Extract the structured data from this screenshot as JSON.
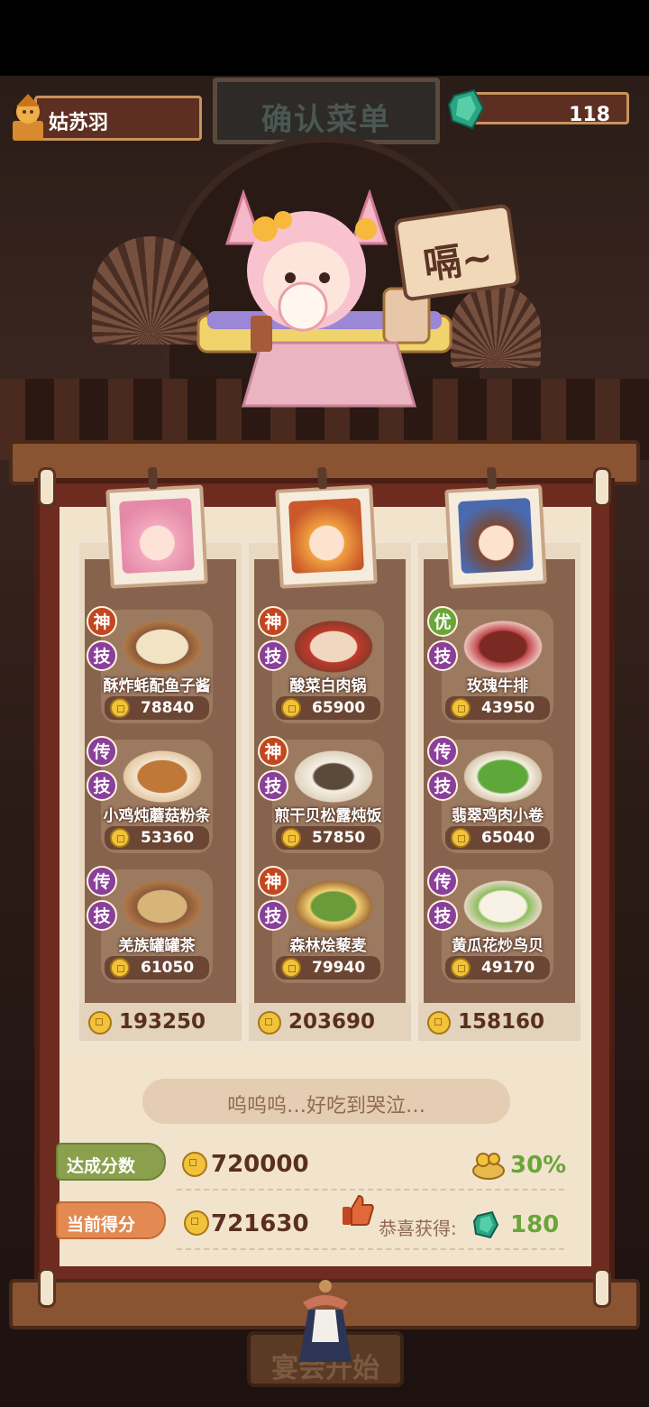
{
  "header": {
    "player_name": "姑苏羽",
    "title": "确认菜单",
    "gems": "118"
  },
  "scene": {
    "speech": "嗝~"
  },
  "columns": [
    {
      "chef": "chef-1",
      "dishes": [
        {
          "rarity": "神",
          "skill": "技",
          "name": "酥炸蚝配鱼子酱",
          "price": "78840"
        },
        {
          "rarity": "传",
          "skill": "技",
          "name": "小鸡炖蘑菇粉条",
          "price": "53360"
        },
        {
          "rarity": "传",
          "skill": "技",
          "name": "羌族罐罐茶",
          "price": "61050"
        }
      ],
      "total": "193250"
    },
    {
      "chef": "chef-2",
      "dishes": [
        {
          "rarity": "神",
          "skill": "技",
          "name": "酸菜白肉锅",
          "price": "65900"
        },
        {
          "rarity": "神",
          "skill": "技",
          "name": "煎干贝松露炖饭",
          "price": "57850"
        },
        {
          "rarity": "神",
          "skill": "技",
          "name": "森林烩藜麦",
          "price": "79940"
        }
      ],
      "total": "203690"
    },
    {
      "chef": "chef-3",
      "dishes": [
        {
          "rarity": "优",
          "skill": "技",
          "name": "玫瑰牛排",
          "price": "43950"
        },
        {
          "rarity": "传",
          "skill": "技",
          "name": "翡翠鸡肉小卷",
          "price": "65040"
        },
        {
          "rarity": "传",
          "skill": "技",
          "name": "黄瓜花炒鸟贝",
          "price": "49170"
        }
      ],
      "total": "158160"
    }
  ],
  "comment": "呜呜呜…好吃到哭泣…",
  "summary": {
    "target_label": "达成分数",
    "target_value": "720000",
    "bonus_pct": "30%",
    "score_label": "当前得分",
    "score_value": "721630",
    "congrats_label": "恭喜获得:",
    "reward": "180"
  },
  "start_button": "宴会开始",
  "colors": {
    "gold": "#f2c33a",
    "green": "#6aa53a",
    "orange": "#e28a52",
    "brown": "#5a2f20"
  }
}
